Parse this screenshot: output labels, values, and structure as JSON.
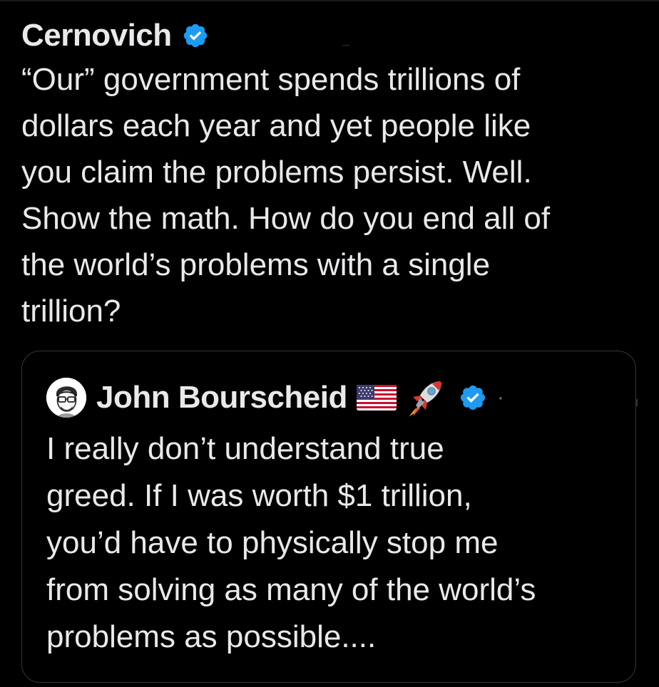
{
  "post": {
    "author": "Cernovich",
    "verified": true,
    "text": "“Our” government spends trillions of\ndollars each year and yet people like\nyou claim the problems persist. Well.\nShow the math. How do you end all of\nthe world’s problems with a single\ntrillion?"
  },
  "quoted_post": {
    "author": "John Bourscheid",
    "author_emojis": [
      "us-flag-emoji",
      "rocket-emoji"
    ],
    "verified": true,
    "separator": "·",
    "text": "I really don’t understand true\ngreed. If I was worth $1 trillion,\nyou’d have to physically stop me\nfrom solving as many of the world’s\nproblems as possible...."
  },
  "colors": {
    "background": "#000000",
    "text": "#e7e9ea",
    "verified_badge": "#1d9bf0",
    "border": "#333639",
    "muted": "#71767b"
  },
  "icons": {
    "verified": "verified-badge-icon",
    "avatar": "cartoon-portrait-avatar"
  }
}
